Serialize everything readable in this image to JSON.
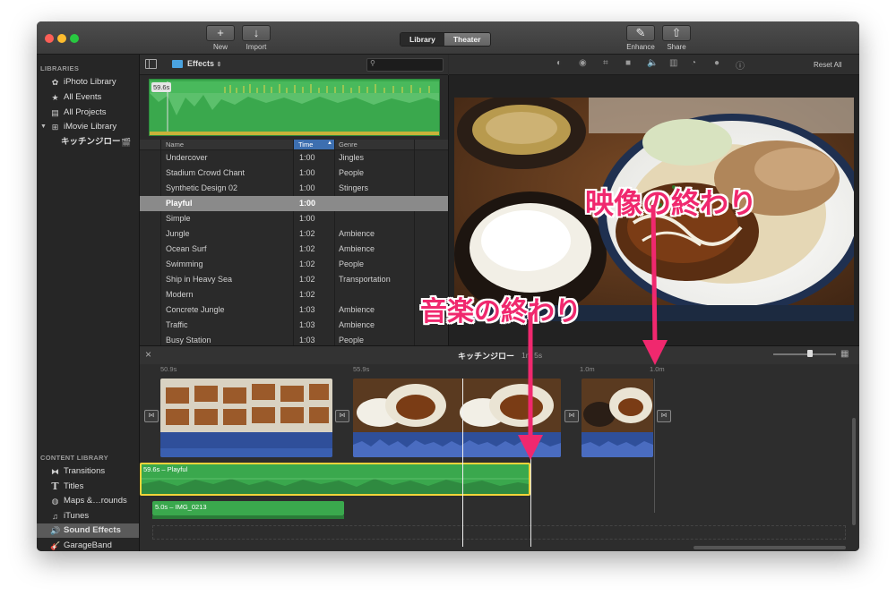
{
  "toolbar": {
    "new_label": "New",
    "import_label": "Import",
    "library_tab": "Library",
    "theater_tab": "Theater",
    "enhance_label": "Enhance",
    "share_label": "Share"
  },
  "sidebar": {
    "libraries_heading": "LIBRARIES",
    "libraries": [
      {
        "label": "iPhoto Library",
        "icon": "iphoto-icon"
      },
      {
        "label": "All Events",
        "icon": "star-icon"
      },
      {
        "label": "All Projects",
        "icon": "film-icon"
      },
      {
        "label": "iMovie Library",
        "icon": "grid-icon"
      },
      {
        "label": "キッチンジロー",
        "icon": "clapper-icon"
      }
    ],
    "content_heading": "CONTENT LIBRARY",
    "content": [
      {
        "label": "Transitions",
        "icon": "transitions-icon"
      },
      {
        "label": "Titles",
        "icon": "titles-icon"
      },
      {
        "label": "Maps &…rounds",
        "icon": "globe-icon"
      },
      {
        "label": "iTunes",
        "icon": "music-note-icon"
      },
      {
        "label": "Sound Effects",
        "icon": "speaker-icon",
        "selected": true
      },
      {
        "label": "GarageBand",
        "icon": "guitar-icon"
      }
    ]
  },
  "browser": {
    "category": "Effects",
    "waveform_duration": "59.6s",
    "columns": {
      "name": "Name",
      "time": "Time",
      "genre": "Genre"
    },
    "rows": [
      {
        "name": "Undercover",
        "time": "1:00",
        "genre": "Jingles"
      },
      {
        "name": "Stadium Crowd Chant",
        "time": "1:00",
        "genre": "People"
      },
      {
        "name": "Synthetic Design 02",
        "time": "1:00",
        "genre": "Stingers"
      },
      {
        "name": "Playful",
        "time": "1:00",
        "genre": "",
        "selected": true
      },
      {
        "name": "Simple",
        "time": "1:00",
        "genre": ""
      },
      {
        "name": "Jungle",
        "time": "1:02",
        "genre": "Ambience"
      },
      {
        "name": "Ocean Surf",
        "time": "1:02",
        "genre": "Ambience"
      },
      {
        "name": "Swimming",
        "time": "1:02",
        "genre": "People"
      },
      {
        "name": "Ship in Heavy Sea",
        "time": "1:02",
        "genre": "Transportation"
      },
      {
        "name": "Modern",
        "time": "1:02",
        "genre": ""
      },
      {
        "name": "Concrete Jungle",
        "time": "1:03",
        "genre": "Ambience"
      },
      {
        "name": "Traffic",
        "time": "1:03",
        "genre": "Ambience"
      },
      {
        "name": "Busy Station",
        "time": "1:03",
        "genre": "People"
      }
    ]
  },
  "viewer": {
    "reset_label": "Reset All",
    "annotation_video_end": "映像の終わり"
  },
  "timeline": {
    "project_title": "キッチンジロー",
    "duration": "1m 5s",
    "timestamps": [
      "50.9s",
      "55.9s",
      "1.0m",
      "1.0m"
    ],
    "music_clip_label": "59.6s – Playful",
    "audio_clip_label": "5.0s – IMG_0213",
    "annotation_music_end": "音楽の終わり"
  },
  "colors": {
    "annotation": "#f0286e",
    "audio_green": "#3aa84d",
    "video_audio_blue": "#2f4f9a"
  }
}
